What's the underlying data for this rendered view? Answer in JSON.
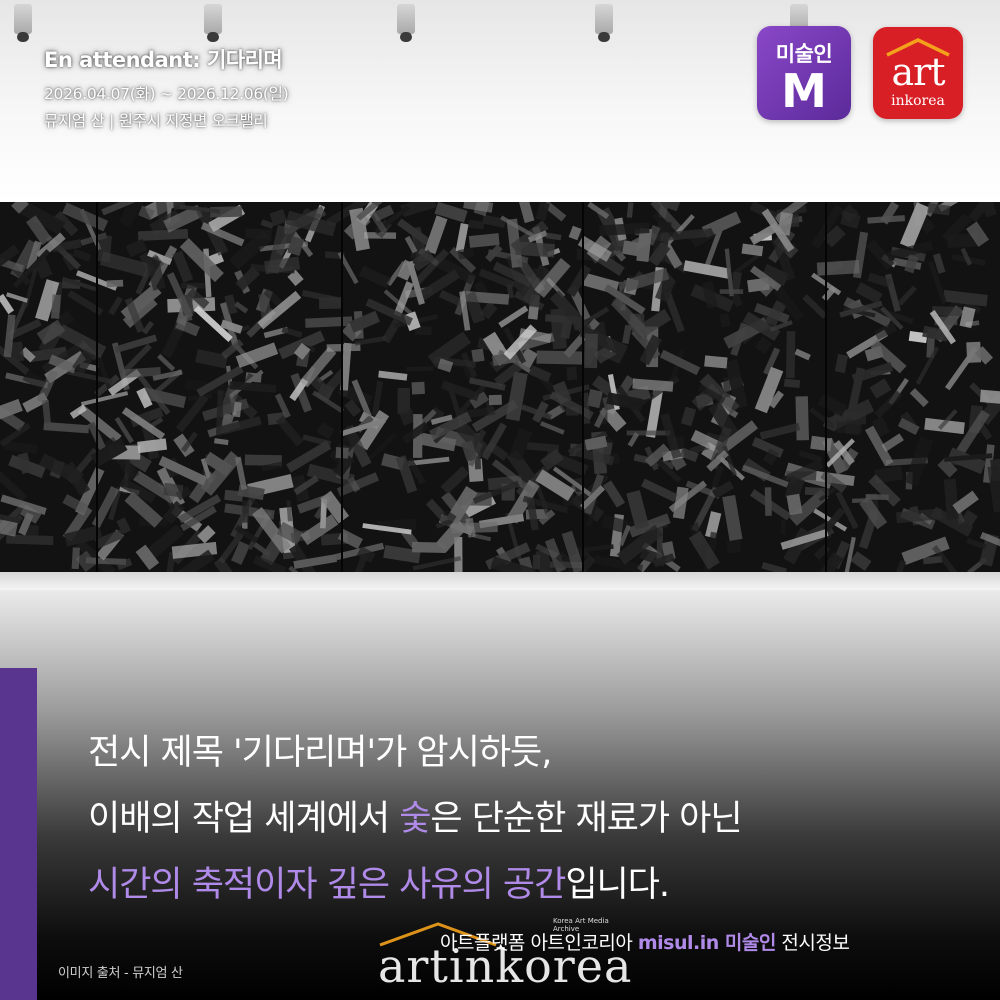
{
  "header": {
    "title": "En attendant: 기다리며",
    "dates": "2026.04.07(화) ~ 2026.12.06(일)",
    "venue": "뮤지엄 산 | 원주시 지정면 오크밸리"
  },
  "logos": {
    "misul_word": "미술인",
    "misul_letter": "M",
    "art_word": "art",
    "art_sub": "inkorea",
    "misul_color": "#6a36ad",
    "art_color": "#d91f26"
  },
  "body": {
    "line1": "전시 제목 '기다리며'가 암시하듯,",
    "line2_a": "이배의 작업 세계에서 ",
    "line2_hl": "숯",
    "line2_b": "은 단순한 재료가 아닌",
    "line3_hl": "시간의 축적이자 깊은 사유의 공간",
    "line3_b": "입니다.",
    "highlight_color": "#b08ae8"
  },
  "footer": {
    "credit": "이미지 출처 - 뮤지엄 산",
    "brand_prefix": "아트플랫폼 아트인코리아",
    "brand_misul": "misul.in 미술인",
    "brand_suffix": "전시정보",
    "watermark_word": "artinkorea",
    "watermark_sub": "Korea Art Media Archive"
  },
  "icons": {
    "ceiling": "ceiling-spotlight-icon",
    "roof": "roof-logo-icon"
  }
}
